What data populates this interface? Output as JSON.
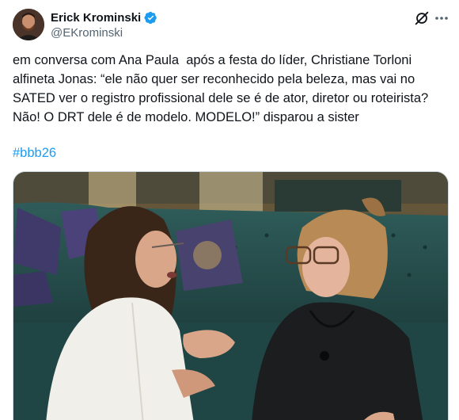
{
  "author": {
    "name": "Erick Krominski",
    "handle": "@EKrominski",
    "verified": true
  },
  "tweet": {
    "text": "em conversa com Ana Paula  após a festa do líder, Christiane Torloni\nalfineta Jonas: “ele não quer ser reconhecido pela beleza, mas vai no\nSATED ver o registro profissional dele se é de ator, diretor ou roteirista?\nNão! O DRT dele é de modelo. MODELO!” disparou a sister",
    "hashtag": "#bbb26"
  },
  "icons": {
    "verified": "verified-badge-icon",
    "grok": "grok-icon",
    "more": "more-options-icon"
  },
  "colors": {
    "verified_blue": "#1d9bf0",
    "hashtag_blue": "#1d9bf0",
    "text_primary": "#0f1419",
    "text_secondary": "#536471"
  }
}
